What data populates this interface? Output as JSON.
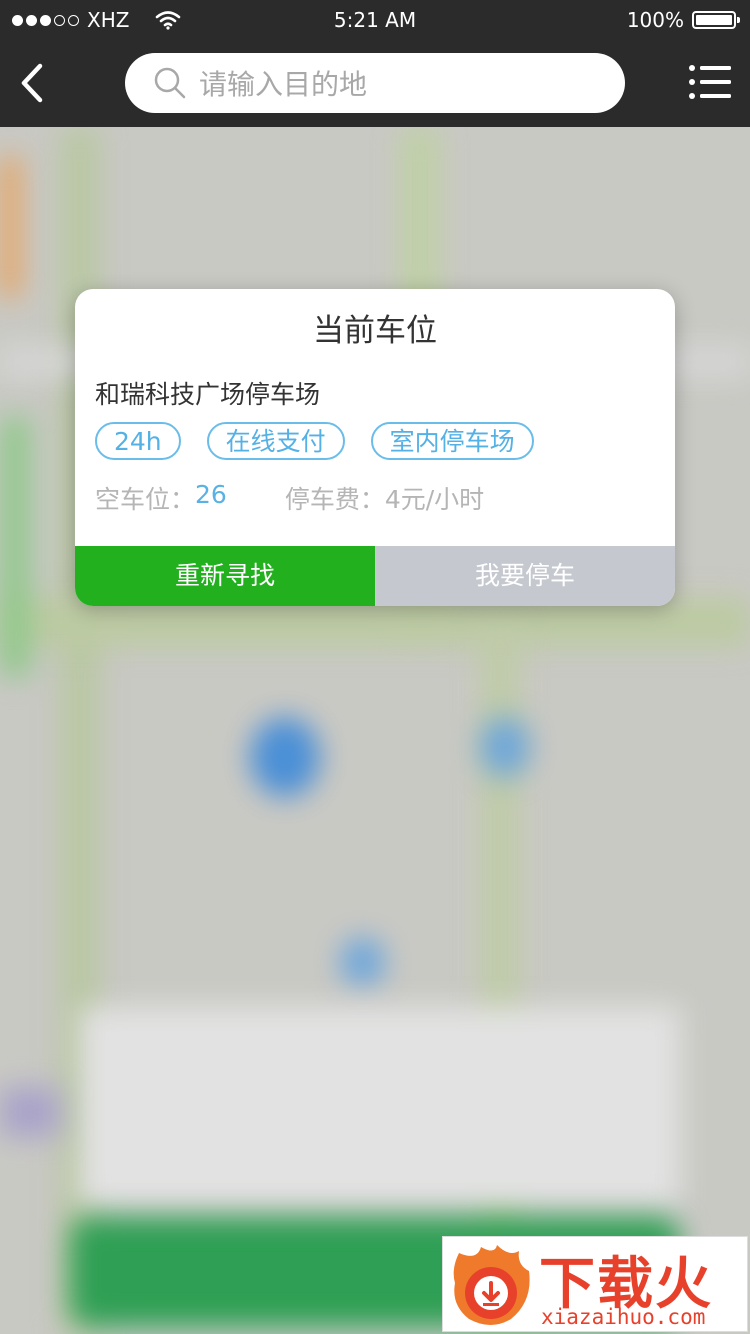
{
  "status_bar": {
    "carrier": "XHZ",
    "time": "5:21 AM",
    "battery": "100%",
    "signal_bars_filled": 3,
    "signal_bars_total": 5
  },
  "nav": {
    "search_placeholder": "请输入目的地"
  },
  "card": {
    "title": "当前车位",
    "lot_name": "和瑞科技广场停车场",
    "tags": [
      "24h",
      "在线支付",
      "室内停车场"
    ],
    "spaces_label": "空车位：",
    "spaces_value": "26",
    "fee_label": "停车费：",
    "fee_value": "4元/小时",
    "btn_research": "重新寻找",
    "btn_park": "我要停车"
  },
  "watermark": {
    "brand_cn": "下载火",
    "brand_en": "xiazaihuo.com"
  },
  "colors": {
    "accent_green": "#22b01f",
    "tag_blue": "#54b1e6",
    "button_gray": "#c5c9cf",
    "bar_dark": "#2b2b2b",
    "brand_red": "#e8412b"
  }
}
